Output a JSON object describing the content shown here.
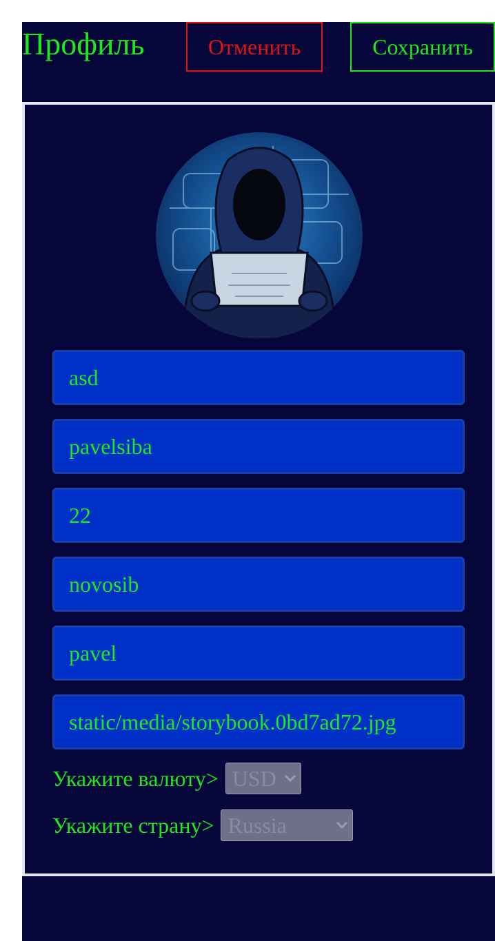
{
  "header": {
    "title": "Профиль",
    "cancel_label": "Отменить",
    "save_label": "Сохранить"
  },
  "profile": {
    "avatar_alt": "hooded hacker avatar",
    "fields": [
      {
        "value": "asd"
      },
      {
        "value": "pavelsiba"
      },
      {
        "value": "22"
      },
      {
        "value": "novosib"
      },
      {
        "value": "pavel"
      },
      {
        "value": "static/media/storybook.0bd7ad72.jpg"
      }
    ],
    "currency": {
      "label": "Укажите валюту>",
      "selected": "USD"
    },
    "country": {
      "label": "Укажите страну>",
      "selected": "Russia"
    }
  },
  "colors": {
    "background": "#07063a",
    "accent_green": "#1ee81e",
    "cancel_red": "#e01414",
    "field_blue": "#0030c8",
    "select_grey": "#6f6f8c"
  }
}
